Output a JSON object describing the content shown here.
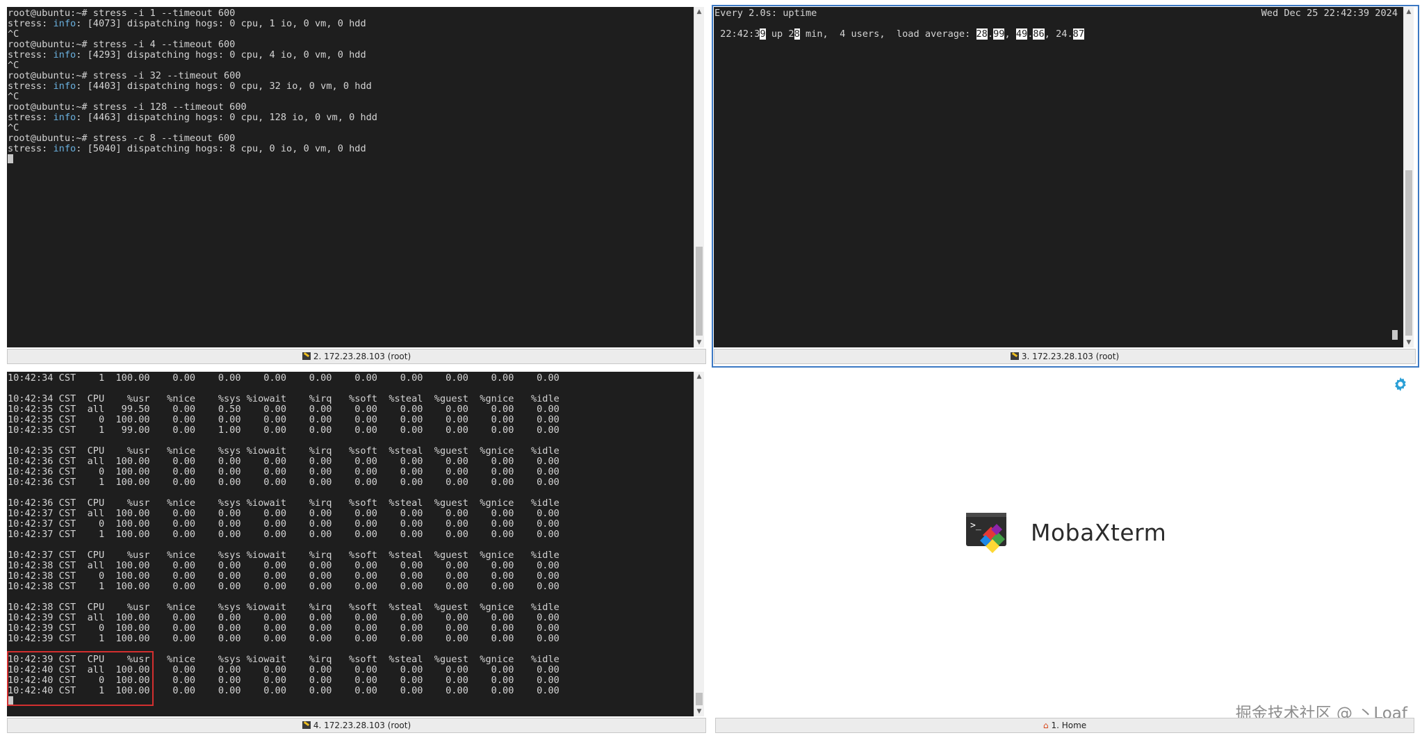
{
  "pane_top_left": {
    "lines": [
      [
        {
          "t": "root@ubuntu:~# stress -i 1 --timeout 600"
        }
      ],
      [
        {
          "t": "stress: "
        },
        {
          "t": "info",
          "c": "info"
        },
        {
          "t": ": [4073] dispatching hogs: 0 cpu, 1 io, 0 vm, 0 hdd"
        }
      ],
      [
        {
          "t": "^C"
        }
      ],
      [
        {
          "t": "root@ubuntu:~# stress -i 4 --timeout 600"
        }
      ],
      [
        {
          "t": "stress: "
        },
        {
          "t": "info",
          "c": "info"
        },
        {
          "t": ": [4293] dispatching hogs: 0 cpu, 4 io, 0 vm, 0 hdd"
        }
      ],
      [
        {
          "t": "^C"
        }
      ],
      [
        {
          "t": "root@ubuntu:~# stress -i 32 --timeout 600"
        }
      ],
      [
        {
          "t": "stress: "
        },
        {
          "t": "info",
          "c": "info"
        },
        {
          "t": ": [4403] dispatching hogs: 0 cpu, 32 io, 0 vm, 0 hdd"
        }
      ],
      [
        {
          "t": "^C"
        }
      ],
      [
        {
          "t": "root@ubuntu:~# stress -i 128 --timeout 600"
        }
      ],
      [
        {
          "t": "stress: "
        },
        {
          "t": "info",
          "c": "info"
        },
        {
          "t": ": [4463] dispatching hogs: 0 cpu, 128 io, 0 vm, 0 hdd"
        }
      ],
      [
        {
          "t": "^C"
        }
      ],
      [
        {
          "t": "root@ubuntu:~# stress -c 8 --timeout 600"
        }
      ],
      [
        {
          "t": "stress: "
        },
        {
          "t": "info",
          "c": "info"
        },
        {
          "t": ": [5040] dispatching hogs: 8 cpu, 0 io, 0 vm, 0 hdd"
        }
      ]
    ],
    "tab_label": "2. 172.23.28.103 (root)"
  },
  "pane_top_right": {
    "header_left": "Every 2.0s: uptime",
    "header_right": "Wed Dec 25 22:42:39 2024",
    "uptime_line": [
      {
        "t": " 22:42:3"
      },
      {
        "t": "9",
        "c": "hl"
      },
      {
        "t": " up 2"
      },
      {
        "t": "8",
        "c": "hl"
      },
      {
        "t": " min,  4 users,  load average: "
      },
      {
        "t": "28",
        "c": "hl"
      },
      {
        "t": "."
      },
      {
        "t": "99",
        "c": "hl"
      },
      {
        "t": ", "
      },
      {
        "t": "49",
        "c": "hl"
      },
      {
        "t": "."
      },
      {
        "t": "86",
        "c": "hl"
      },
      {
        "t": ", 24."
      },
      {
        "t": "87",
        "c": "hl"
      }
    ],
    "tab_label": "3. 172.23.28.103 (root)"
  },
  "pane_bottom_left": {
    "lines": [
      "10:42:34 CST    1  100.00    0.00    0.00    0.00    0.00    0.00    0.00    0.00    0.00    0.00",
      "",
      "10:42:34 CST  CPU    %usr   %nice    %sys %iowait    %irq   %soft  %steal  %guest  %gnice   %idle",
      "10:42:35 CST  all   99.50    0.00    0.50    0.00    0.00    0.00    0.00    0.00    0.00    0.00",
      "10:42:35 CST    0  100.00    0.00    0.00    0.00    0.00    0.00    0.00    0.00    0.00    0.00",
      "10:42:35 CST    1   99.00    0.00    1.00    0.00    0.00    0.00    0.00    0.00    0.00    0.00",
      "",
      "10:42:35 CST  CPU    %usr   %nice    %sys %iowait    %irq   %soft  %steal  %guest  %gnice   %idle",
      "10:42:36 CST  all  100.00    0.00    0.00    0.00    0.00    0.00    0.00    0.00    0.00    0.00",
      "10:42:36 CST    0  100.00    0.00    0.00    0.00    0.00    0.00    0.00    0.00    0.00    0.00",
      "10:42:36 CST    1  100.00    0.00    0.00    0.00    0.00    0.00    0.00    0.00    0.00    0.00",
      "",
      "10:42:36 CST  CPU    %usr   %nice    %sys %iowait    %irq   %soft  %steal  %guest  %gnice   %idle",
      "10:42:37 CST  all  100.00    0.00    0.00    0.00    0.00    0.00    0.00    0.00    0.00    0.00",
      "10:42:37 CST    0  100.00    0.00    0.00    0.00    0.00    0.00    0.00    0.00    0.00    0.00",
      "10:42:37 CST    1  100.00    0.00    0.00    0.00    0.00    0.00    0.00    0.00    0.00    0.00",
      "",
      "10:42:37 CST  CPU    %usr   %nice    %sys %iowait    %irq   %soft  %steal  %guest  %gnice   %idle",
      "10:42:38 CST  all  100.00    0.00    0.00    0.00    0.00    0.00    0.00    0.00    0.00    0.00",
      "10:42:38 CST    0  100.00    0.00    0.00    0.00    0.00    0.00    0.00    0.00    0.00    0.00",
      "10:42:38 CST    1  100.00    0.00    0.00    0.00    0.00    0.00    0.00    0.00    0.00    0.00",
      "",
      "10:42:38 CST  CPU    %usr   %nice    %sys %iowait    %irq   %soft  %steal  %guest  %gnice   %idle",
      "10:42:39 CST  all  100.00    0.00    0.00    0.00    0.00    0.00    0.00    0.00    0.00    0.00",
      "10:42:39 CST    0  100.00    0.00    0.00    0.00    0.00    0.00    0.00    0.00    0.00    0.00",
      "10:42:39 CST    1  100.00    0.00    0.00    0.00    0.00    0.00    0.00    0.00    0.00    0.00",
      "",
      "10:42:39 CST  CPU    %usr   %nice    %sys %iowait    %irq   %soft  %steal  %guest  %gnice   %idle",
      "10:42:40 CST  all  100.00    0.00    0.00    0.00    0.00    0.00    0.00    0.00    0.00    0.00",
      "10:42:40 CST    0  100.00    0.00    0.00    0.00    0.00    0.00    0.00    0.00    0.00    0.00",
      "10:42:40 CST    1  100.00    0.00    0.00    0.00    0.00    0.00    0.00    0.00    0.00    0.00"
    ],
    "tab_label": "4. 172.23.28.103 (root)"
  },
  "pane_bottom_right": {
    "app_name": "MobaXterm",
    "tab_label": "1. Home",
    "watermark": "掘金技术社区 @ 丶Loaf"
  },
  "colors": {
    "terminal_bg": "#1e1e1e",
    "terminal_fg": "#d4d4d4",
    "info_color": "#6ab0de",
    "active_border": "#3b78c3",
    "highlight_box": "#d32f2f",
    "gear_color": "#2a9fd6"
  }
}
